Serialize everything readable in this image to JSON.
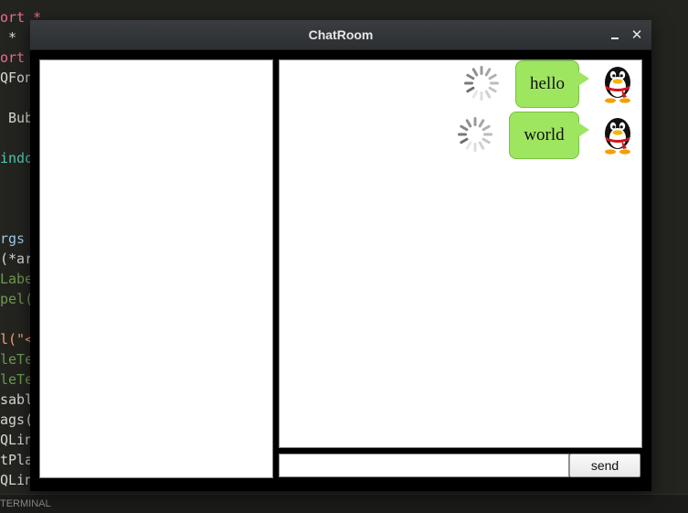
{
  "editor": {
    "lines": [
      {
        "text": "ort *",
        "cls": "c-pink"
      },
      {
        "text": " *",
        "cls": "c-white"
      },
      {
        "text": "ort",
        "cls": "c-pink"
      },
      {
        "text": "QFon",
        "cls": "c-white"
      },
      {
        "text": "",
        "cls": "c-white"
      },
      {
        "text": " Bub",
        "cls": "c-white"
      },
      {
        "text": "",
        "cls": "c-white"
      },
      {
        "text": "indo",
        "cls": "c-teal"
      },
      {
        "text": "",
        "cls": "c-white"
      },
      {
        "text": "",
        "cls": "c-white"
      },
      {
        "text": "",
        "cls": "c-white"
      },
      {
        "text": "rgs",
        "cls": "c-lblue"
      },
      {
        "text": "(*ar",
        "cls": "c-white"
      },
      {
        "text": "Labe",
        "cls": "c-green"
      },
      {
        "text": "pel(",
        "cls": "c-green"
      },
      {
        "text": "",
        "cls": "c-white"
      },
      {
        "text": "l(\"<",
        "cls": "c-orange"
      },
      {
        "text": "leTe",
        "cls": "c-green"
      },
      {
        "text": "leTe",
        "cls": "c-green"
      },
      {
        "text": "sabl",
        "cls": "c-white"
      },
      {
        "text": "ags(",
        "cls": "c-white"
      },
      {
        "text": "QLin",
        "cls": "c-white"
      },
      {
        "text": "tPla",
        "cls": "c-white"
      },
      {
        "text": "QLin",
        "cls": "c-white"
      }
    ]
  },
  "panel": {
    "terminal_label": "TERMINAL"
  },
  "window": {
    "title": "ChatRoom",
    "close_glyph": "✕"
  },
  "chat": {
    "messages": [
      {
        "text": "hello"
      },
      {
        "text": "world"
      }
    ]
  },
  "input": {
    "value": "",
    "placeholder": ""
  },
  "send": {
    "label": "send"
  },
  "colors": {
    "bubble": "#9ee560",
    "window_bg": "#000000",
    "titlebar": "#2d3033"
  },
  "icons": {
    "avatar": "penguin-avatar-icon",
    "spinner": "loading-spinner-icon"
  }
}
